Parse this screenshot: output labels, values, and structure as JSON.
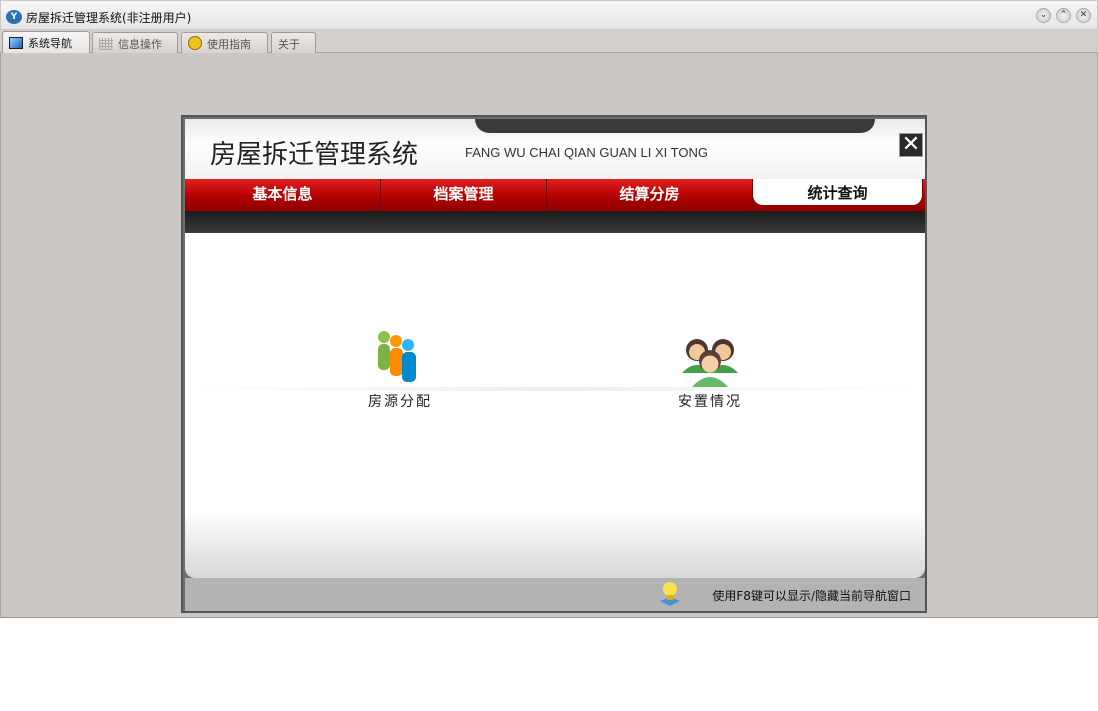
{
  "window": {
    "title": "房屋拆迁管理系统(非注册用户)",
    "controls": [
      "minimize",
      "maximize",
      "close"
    ]
  },
  "tabs": [
    {
      "label": "系统导航",
      "active": true
    },
    {
      "label": "信息操作"
    },
    {
      "label": "使用指南"
    },
    {
      "label": "关于"
    }
  ],
  "panel": {
    "title": "房屋拆迁管理系统",
    "subtitle": "FANG WU CHAI QIAN GUAN LI XI TONG",
    "nav": [
      {
        "label": "基本信息"
      },
      {
        "label": "档案管理"
      },
      {
        "label": "结算分房"
      },
      {
        "label": "统计查询",
        "active": true
      }
    ],
    "items": [
      {
        "label": "房源分配",
        "icon": "people-color-icon"
      },
      {
        "label": "安置情况",
        "icon": "users-group-icon"
      }
    ],
    "tip": "使用F8键可以显示/隐藏当前导航窗口"
  }
}
